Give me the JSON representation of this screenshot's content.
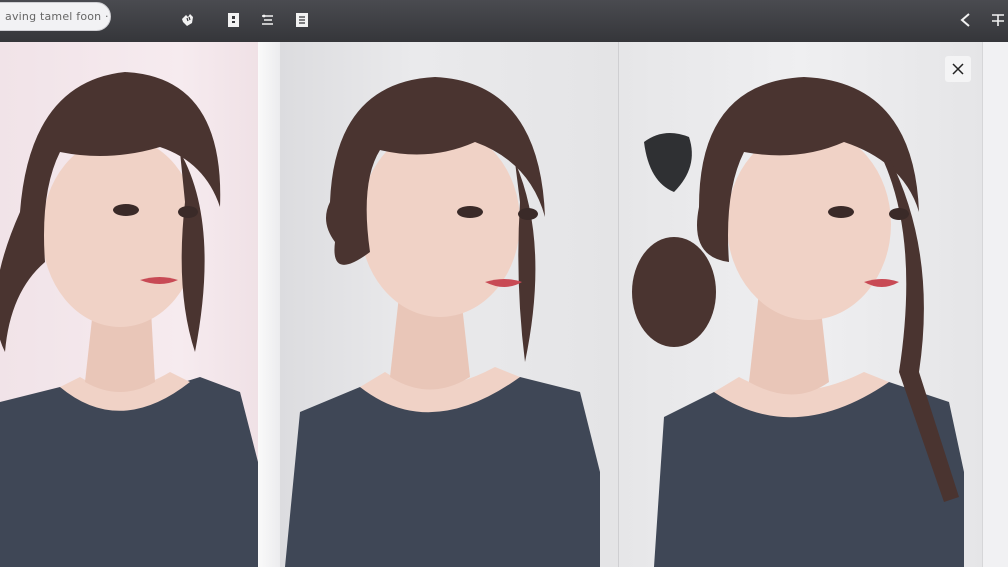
{
  "toolbar": {
    "search_text": "aving tamel foon ·",
    "icons": [
      "hand-pointer-icon",
      "file-icon",
      "list-settings-icon",
      "document-icon",
      "back-chevron-icon",
      "text-cursor-icon"
    ]
  },
  "viewer": {
    "images": [
      "portrait-1",
      "portrait-2",
      "portrait-3"
    ],
    "close_icon": "close-icon"
  },
  "colors": {
    "toolbar": "#3e3f43",
    "panel1_bg": "#f4e6eb",
    "sweater": "#3f4756",
    "hair": "#4a3430",
    "skin": "#f0d2c6"
  }
}
